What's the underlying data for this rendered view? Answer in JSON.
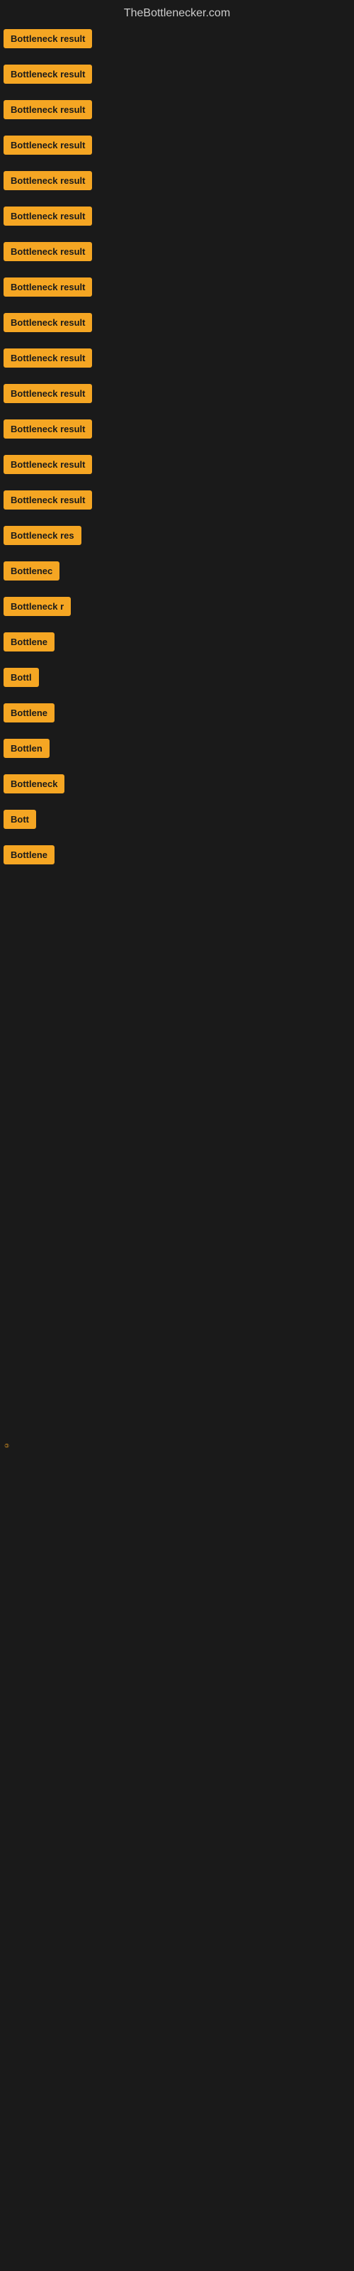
{
  "site": {
    "title": "TheBottlenecker.com"
  },
  "items": [
    {
      "id": 1,
      "label": "Bottleneck result",
      "width": 135
    },
    {
      "id": 2,
      "label": "Bottleneck result",
      "width": 135
    },
    {
      "id": 3,
      "label": "Bottleneck result",
      "width": 135
    },
    {
      "id": 4,
      "label": "Bottleneck result",
      "width": 135
    },
    {
      "id": 5,
      "label": "Bottleneck result",
      "width": 135
    },
    {
      "id": 6,
      "label": "Bottleneck result",
      "width": 135
    },
    {
      "id": 7,
      "label": "Bottleneck result",
      "width": 135
    },
    {
      "id": 8,
      "label": "Bottleneck result",
      "width": 135
    },
    {
      "id": 9,
      "label": "Bottleneck result",
      "width": 135
    },
    {
      "id": 10,
      "label": "Bottleneck result",
      "width": 135
    },
    {
      "id": 11,
      "label": "Bottleneck result",
      "width": 135
    },
    {
      "id": 12,
      "label": "Bottleneck result",
      "width": 135
    },
    {
      "id": 13,
      "label": "Bottleneck result",
      "width": 135
    },
    {
      "id": 14,
      "label": "Bottleneck result",
      "width": 135
    },
    {
      "id": 15,
      "label": "Bottleneck res",
      "width": 110
    },
    {
      "id": 16,
      "label": "Bottlenec",
      "width": 80
    },
    {
      "id": 17,
      "label": "Bottleneck r",
      "width": 95
    },
    {
      "id": 18,
      "label": "Bottlene",
      "width": 75
    },
    {
      "id": 19,
      "label": "Bottl",
      "width": 55
    },
    {
      "id": 20,
      "label": "Bottlene",
      "width": 75
    },
    {
      "id": 21,
      "label": "Bottlen",
      "width": 68
    },
    {
      "id": 22,
      "label": "Bottleneck",
      "width": 88
    },
    {
      "id": 23,
      "label": "Bott",
      "width": 48
    },
    {
      "id": 24,
      "label": "Bottlene",
      "width": 75
    }
  ],
  "footer": {
    "watermark": "©"
  }
}
